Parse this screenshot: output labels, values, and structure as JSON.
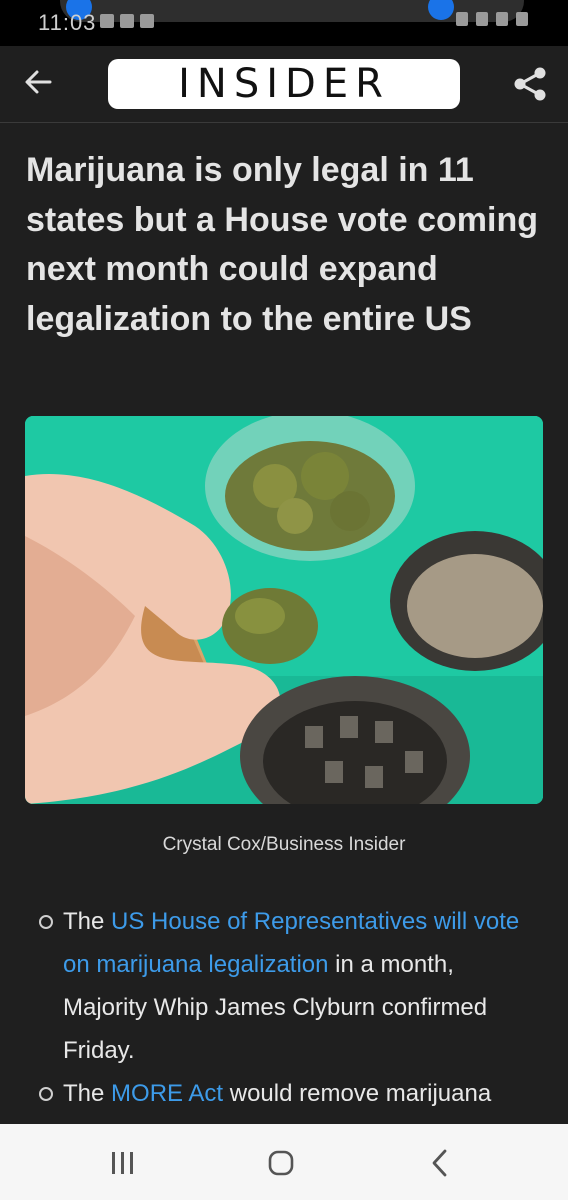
{
  "status_bar": {
    "time": "11:03"
  },
  "header": {
    "logo_text": "INSIDER"
  },
  "article": {
    "headline": "Marijuana is only legal in 11 states but a House vote coming next month could expand legalization to the entire US",
    "image_caption": "Crystal Cox/Business Insider",
    "bullets": [
      {
        "pre": "The ",
        "link": "US House of Representatives will vote on marijuana legalization",
        "post": " in a month, Majority Whip James Clyburn confirmed Friday."
      },
      {
        "pre": "The ",
        "link": "MORE Act",
        "post": " would remove marijuana"
      }
    ]
  },
  "icons": {
    "back": "arrow-left-icon",
    "share": "share-icon",
    "nav_recent": "recent-apps-icon",
    "nav_home": "home-icon",
    "nav_back": "chevron-left-icon"
  },
  "colors": {
    "background": "#1f1f1f",
    "link": "#3d9be9",
    "logo_bg": "#ffffff",
    "image_teal": "#1ec9a3"
  }
}
